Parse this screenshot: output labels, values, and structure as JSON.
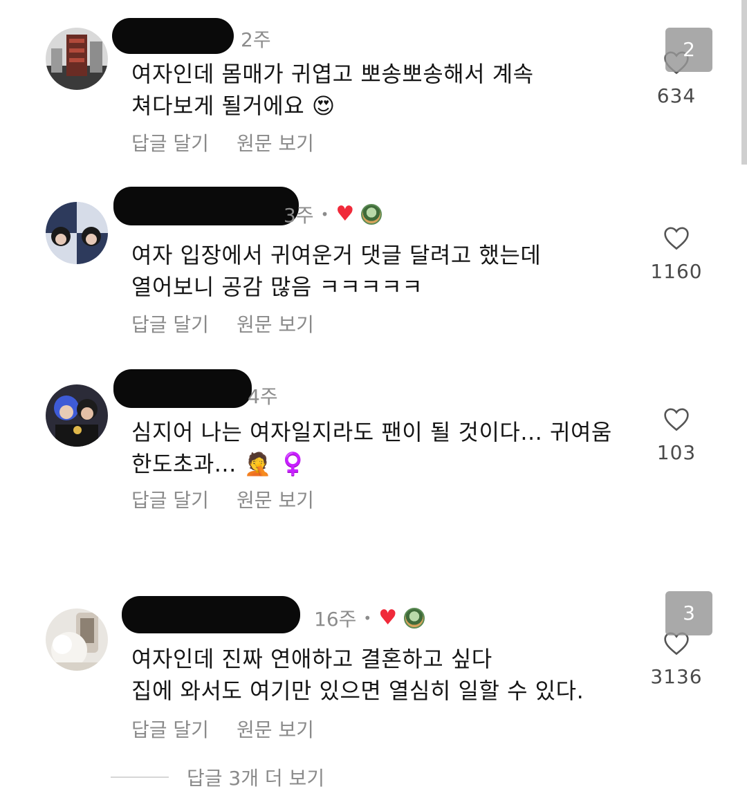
{
  "comments": [
    {
      "time": "2주",
      "lines": [
        "여자인데 몸매가 귀엽고 뽀송뽀송해서 계속",
        "쳐다보게 될거에요 😍"
      ],
      "reply_label": "답글 달기",
      "original_label": "원문 보기",
      "likes": "634",
      "badge": "2",
      "creator_liked": false
    },
    {
      "time": "3주",
      "lines": [
        "여자 입장에서 귀여운거 댓글 달려고 했는데",
        "열어보니 공감 많음 ㅋㅋㅋㅋㅋ"
      ],
      "reply_label": "답글 달기",
      "original_label": "원문 보기",
      "likes": "1160",
      "creator_liked": true
    },
    {
      "time": "4주",
      "lines": [
        "심지어 나는 여자일지라도 팬이 될 것이다... 귀여움",
        "한도초과... 🤦 ♀️"
      ],
      "reply_label": "답글 달기",
      "original_label": "원문 보기",
      "likes": "103",
      "creator_liked": false
    },
    {
      "time": "16주",
      "lines": [
        "여자인데 진짜 연애하고 결혼하고 싶다",
        "집에 와서도 여기만 있으면 열심히 일할 수 있다."
      ],
      "reply_label": "답글 달기",
      "original_label": "원문 보기",
      "likes": "3136",
      "badge": "3",
      "creator_liked": true
    }
  ],
  "more_replies": "답글 3개 더 보기",
  "colors": {
    "secondary_text": "#8a8a8a",
    "heart_red": "#f02a3a",
    "redaction": "#0a0a0a"
  }
}
